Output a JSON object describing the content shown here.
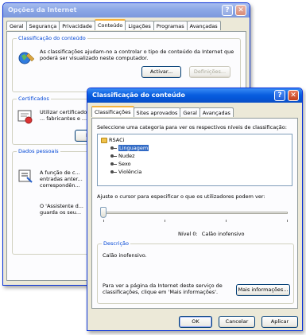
{
  "back_window": {
    "title": "Opções da Internet",
    "tabs": [
      "Geral",
      "Segurança",
      "Privacidade",
      "Conteúdo",
      "Ligações",
      "Programas",
      "Avançadas"
    ],
    "ratings_group": {
      "legend": "Classificação do conteúdo",
      "text": "As classificações ajudam-no a controlar o tipo de conteúdo da Internet que poderá ser visualizado neste computador.",
      "activate_label": "Activar...",
      "settings_label": "Definições..."
    },
    "certificates_group": {
      "legend": "Certificados",
      "text": "Utilizar certificados ... fabricantes e ...",
      "button_label": "Lim"
    },
    "personal_group": {
      "legend": "Dados pessoais",
      "text1": "A função de c... entradas anter... correspondên...",
      "text2": "O 'Assistente d... guarda os seu..."
    }
  },
  "front_window": {
    "title": "Classificação do conteúdo",
    "tabs": [
      "Classificações",
      "Sites aprovados",
      "Geral",
      "Avançadas"
    ],
    "instruction": "Seleccione uma categoria para ver os respectivos níveis de classificação:",
    "tree": {
      "root": "RSACi",
      "items": [
        "Linguagem",
        "Nudez",
        "Sexo",
        "Violência"
      ]
    },
    "slider_instruction": "Ajuste o cursor para especificar o que os utilizadores podem ver:",
    "level": {
      "level_label": "Nível 0:",
      "level_name": "Calão inofensivo",
      "value": 0
    },
    "description": {
      "legend": "Descrição",
      "text": "Calão inofensivo.",
      "more_info_text": "Para ver a página da Internet deste serviço de classificações, clique em 'Mais informações'.",
      "more_info_button": "Mais informações..."
    },
    "buttons": {
      "ok": "OK",
      "cancel": "Cancelar",
      "apply": "Aplicar"
    }
  },
  "colors": {
    "titlebar": "#0a5fe0",
    "legend_text": "#0046d5",
    "selection": "#316ac5",
    "window_face": "#ece9d8"
  }
}
